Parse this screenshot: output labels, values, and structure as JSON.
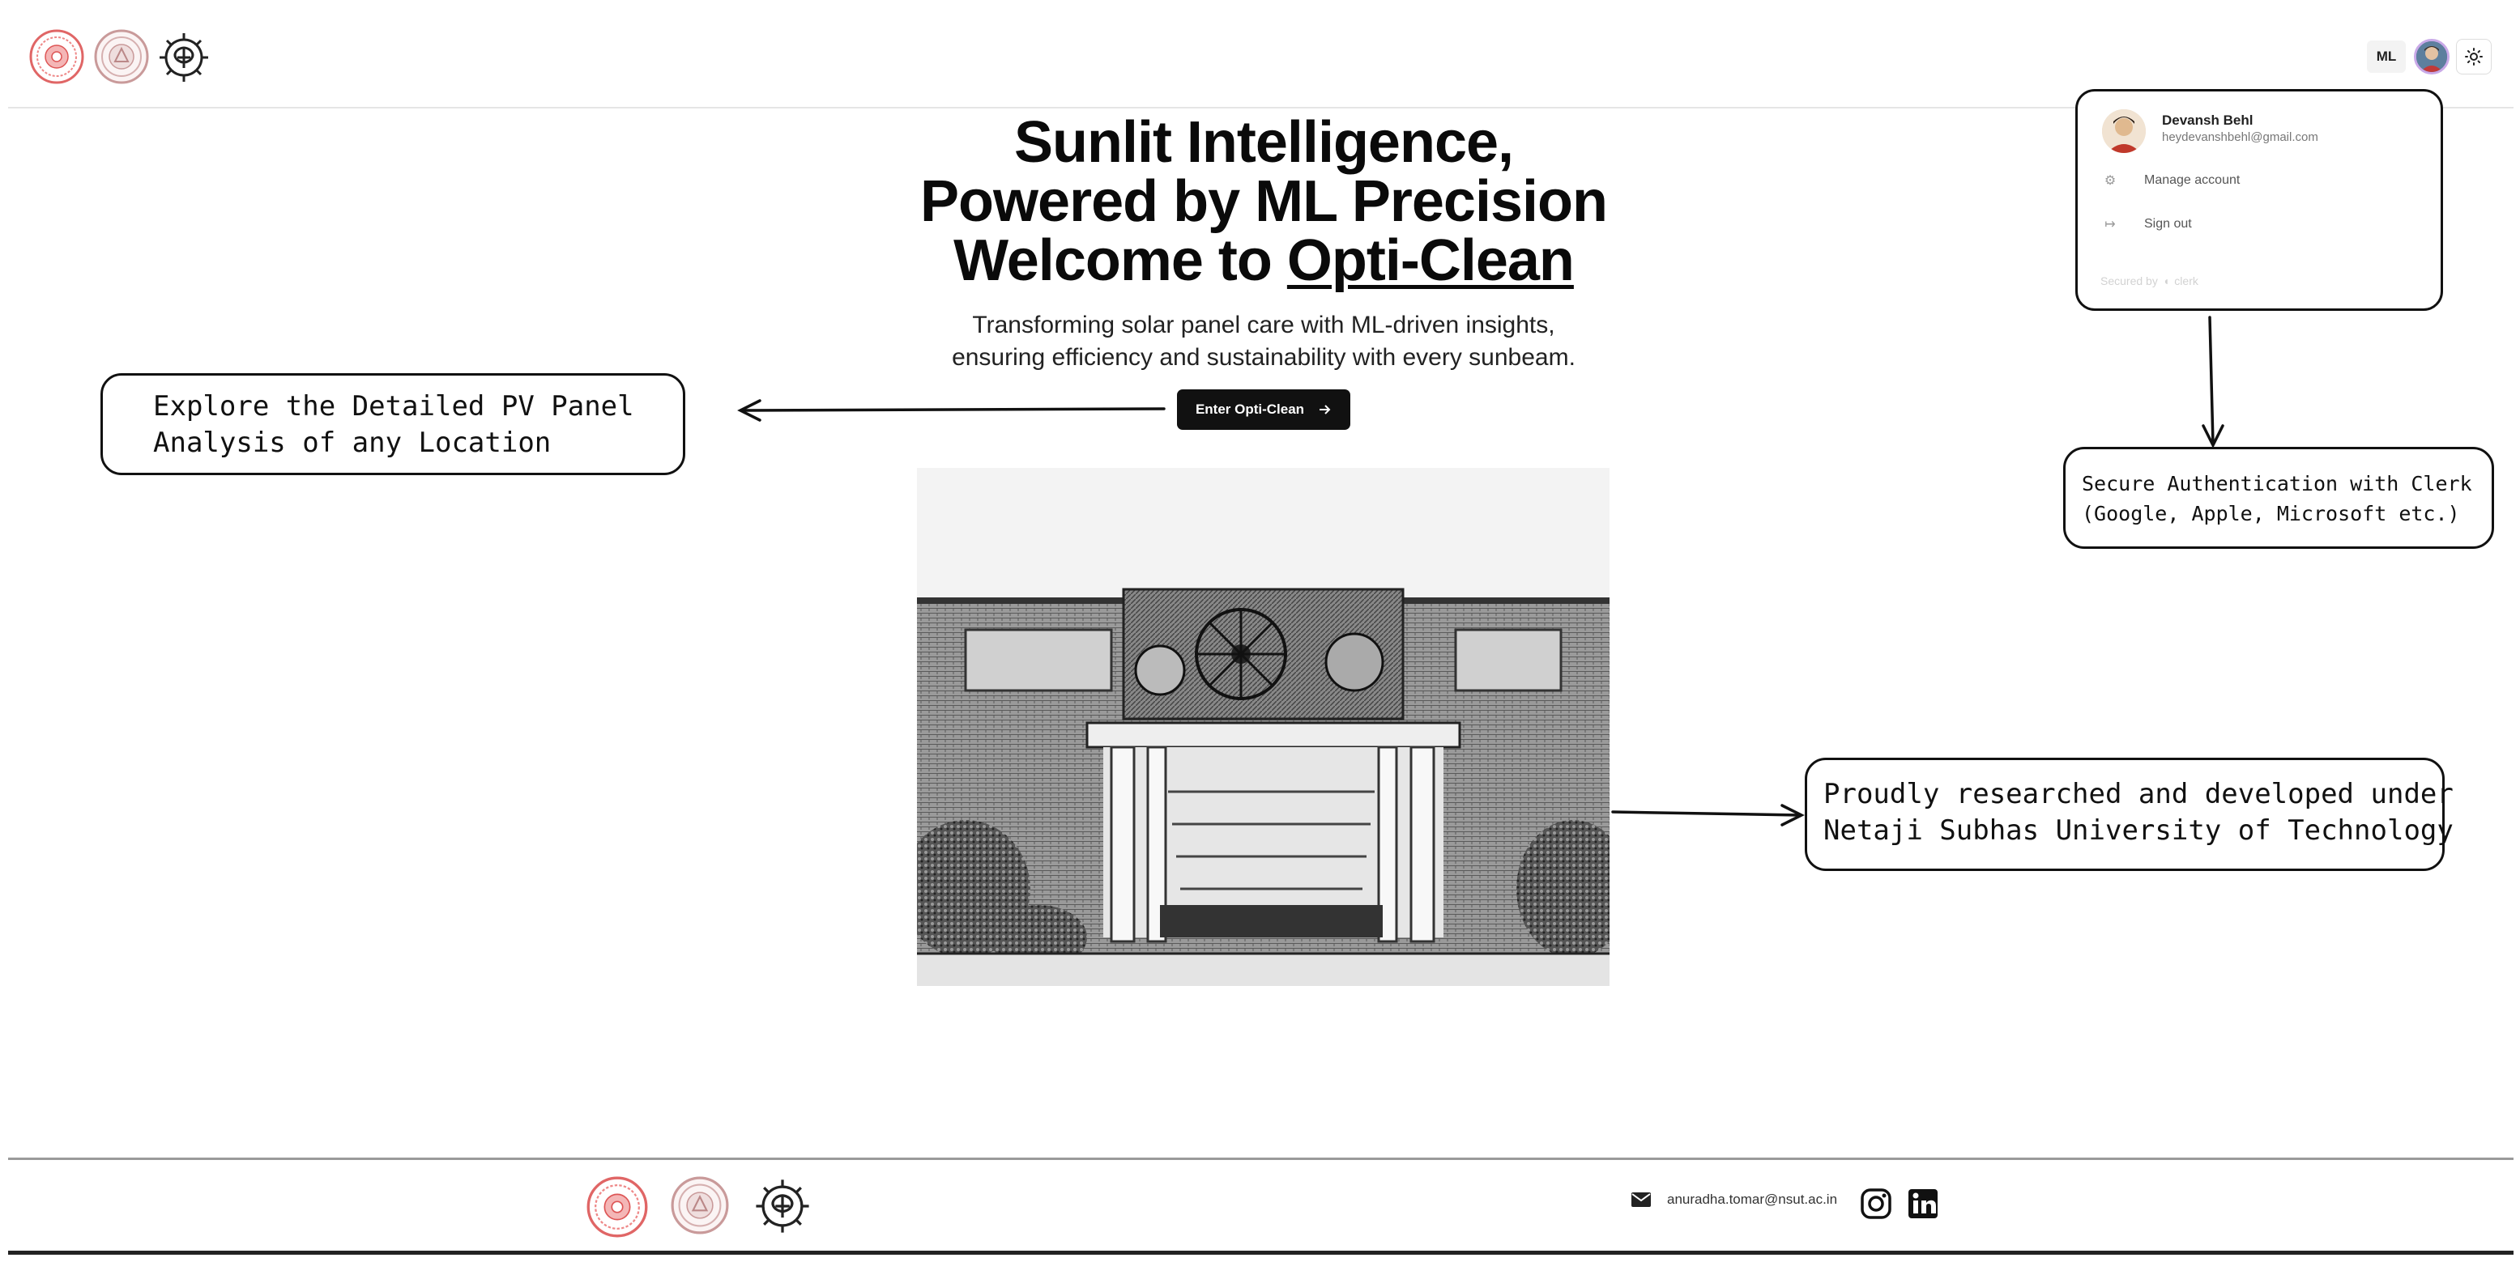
{
  "header": {
    "logos": [
      "nsut-seal-icon",
      "university-seal-icon",
      "ml-gear-brain-icon"
    ],
    "ml_badge": "ML",
    "avatar": "user-avatar",
    "theme_toggle_icon": "sun-icon"
  },
  "hero": {
    "title_line1": "Sunlit Intelligence,",
    "title_line2": "Powered by ML Precision",
    "title_line3_prefix": "Welcome to ",
    "title_line3_brand": "Opti-Clean",
    "subtitle_line1": "Transforming solar panel care with ML-driven insights,",
    "subtitle_line2": "ensuring efficiency and sustainability with every sunbeam.",
    "cta_label": "Enter Opti-Clean",
    "cta_icon": "arrow-right-icon",
    "image": "university-building-sketch"
  },
  "user_menu": {
    "name": "Devansh Behl",
    "email": "heydevanshbehl@gmail.com",
    "manage_account": "Manage account",
    "manage_account_icon": "gear-icon",
    "sign_out": "Sign out",
    "sign_out_icon": "sign-out-icon",
    "secured_by": "Secured by",
    "secured_brand": "clerk"
  },
  "annotations": {
    "left_line1": "Explore the Detailed PV Panel",
    "left_line2": "Analysis of any Location",
    "auth_line1": "Secure Authentication with Clerk",
    "auth_line2": "(Google, Apple, Microsoft etc.)",
    "nsut_line1": "Proudly researched and developed under",
    "nsut_line2": "Netaji Subhas University of Technology"
  },
  "footer": {
    "email": "anuradha.tomar@nsut.ac.in",
    "email_icon": "mail-icon",
    "social_icons": [
      "instagram-icon",
      "linkedin-icon"
    ]
  },
  "colors": {
    "primary_button": "#111111",
    "seal_red": "#e06666",
    "seal_rose": "#c99a9a",
    "annotation_border": "#111111"
  }
}
